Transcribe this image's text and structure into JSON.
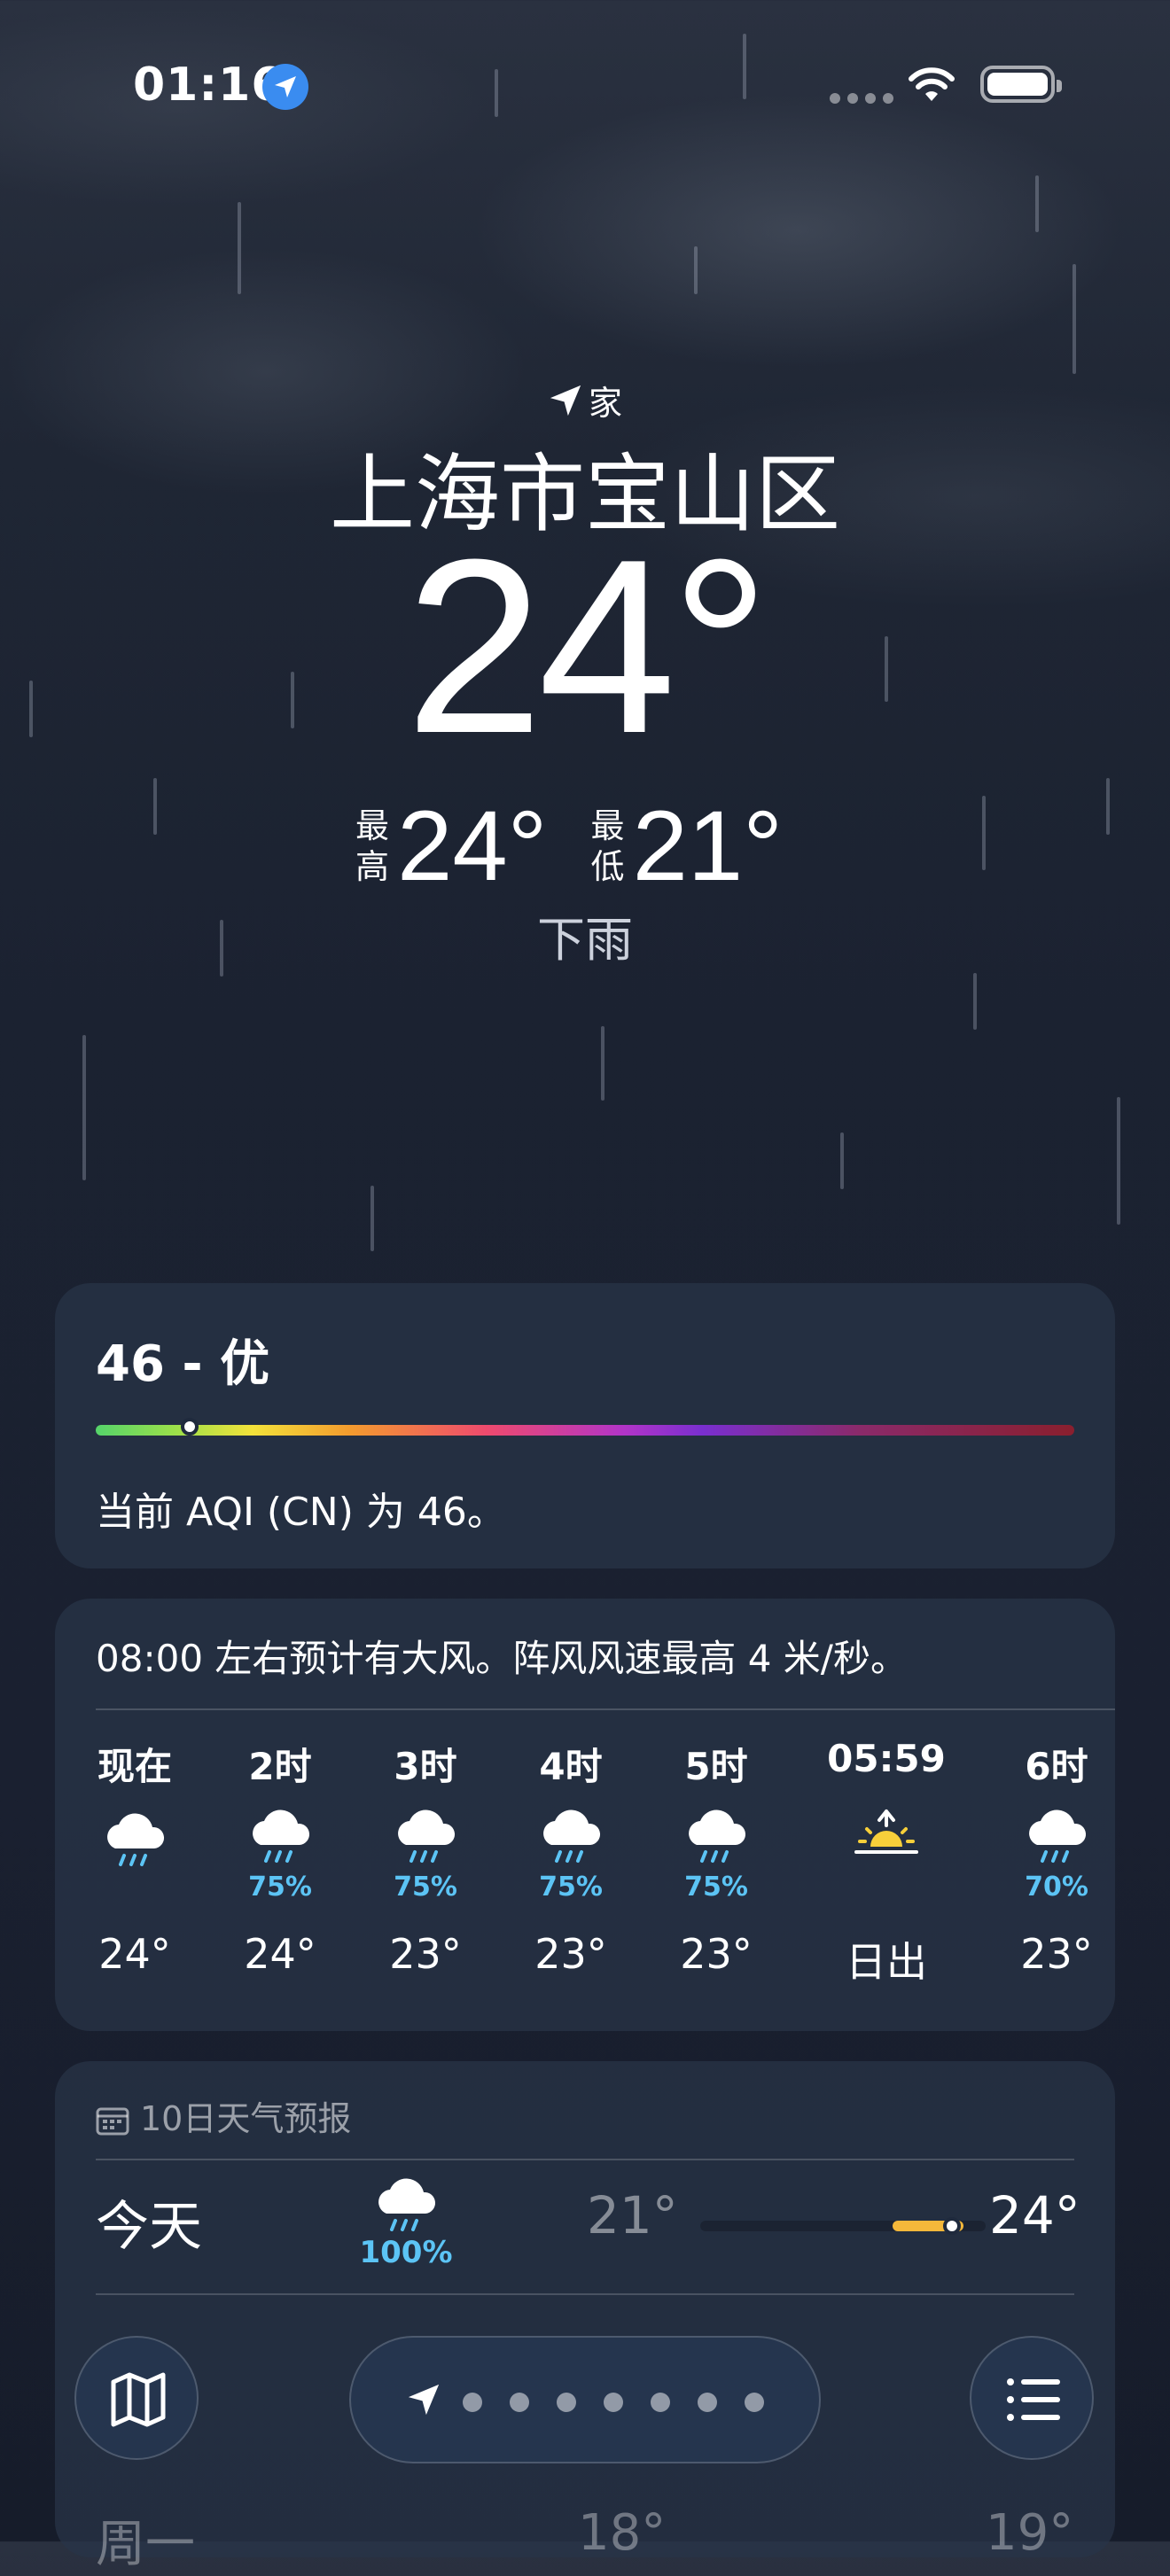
{
  "status_bar": {
    "time": "01:16",
    "icons": [
      "location-arrow-icon",
      "cellular-dots-icon",
      "wifi-icon",
      "battery-icon"
    ]
  },
  "header": {
    "home_label": "家",
    "city": "上海市宝山区",
    "temperature": "24°",
    "high_label": "最高",
    "high": "24°",
    "low_label": "最低",
    "low": "21°",
    "condition": "下雨"
  },
  "aqi": {
    "title": "46 - 优",
    "description": "当前 AQI (CN) 为 46。",
    "value": 46
  },
  "hourly": {
    "summary": "08:00 左右预计有大风。阵风风速最高 4 米/秒。",
    "items": [
      {
        "time": "现在",
        "icon": "rain-icon",
        "precip": "",
        "temp": "24°"
      },
      {
        "time": "2时",
        "icon": "rain-icon",
        "precip": "75%",
        "temp": "24°"
      },
      {
        "time": "3时",
        "icon": "rain-icon",
        "precip": "75%",
        "temp": "23°"
      },
      {
        "time": "4时",
        "icon": "rain-icon",
        "precip": "75%",
        "temp": "23°"
      },
      {
        "time": "5时",
        "icon": "rain-icon",
        "precip": "75%",
        "temp": "23°"
      },
      {
        "time": "05:59",
        "icon": "sunrise-icon",
        "precip": "",
        "temp": "日出"
      },
      {
        "time": "6时",
        "icon": "rain-icon",
        "precip": "70%",
        "temp": "23°"
      }
    ]
  },
  "ten_day": {
    "header": "10日天气预报",
    "today": {
      "day": "今天",
      "icon": "rain-icon",
      "precip": "100%",
      "low": "21°",
      "high": "24°"
    },
    "next": {
      "day": "周一",
      "low": "18°",
      "high": "19°"
    }
  },
  "toolbar": {
    "map_icon": "map-icon",
    "list_icon": "list-icon",
    "page_count": 7
  },
  "colors": {
    "accent_blue": "#3a8cf0",
    "precip_blue": "#5cc4f5",
    "temp_bar": "#f5b83a"
  }
}
